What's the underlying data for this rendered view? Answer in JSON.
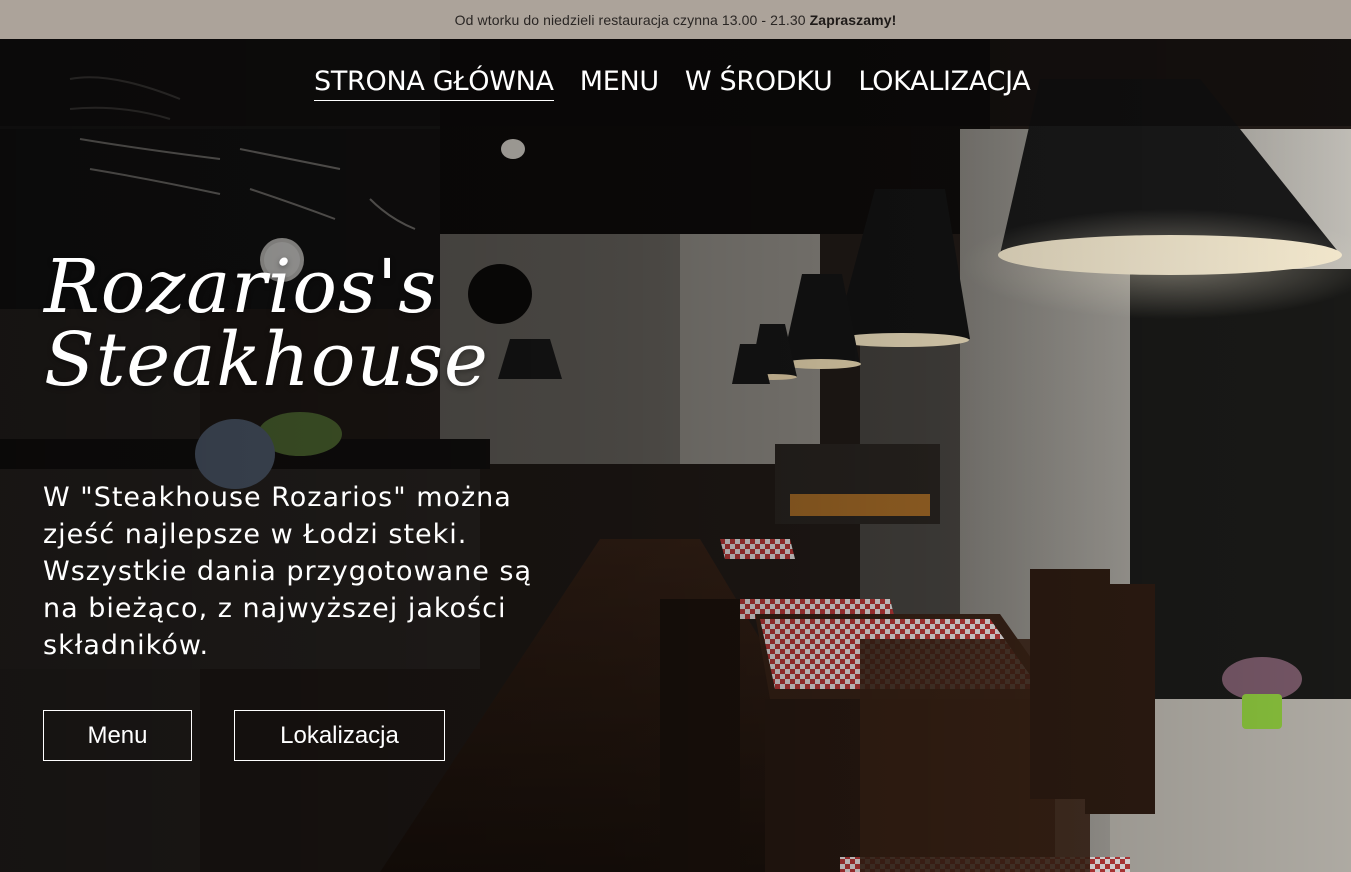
{
  "topbar": {
    "text": "Od wtorku do niedzieli restauracja czynna 13.00 - 21.30",
    "emphasis": "Zapraszamy!"
  },
  "nav": {
    "items": [
      {
        "label": "STRONA GŁÓWNA",
        "active": true
      },
      {
        "label": "MENU",
        "active": false
      },
      {
        "label": "W ŚRODKU",
        "active": false
      },
      {
        "label": "LOKALIZACJA",
        "active": false
      }
    ]
  },
  "hero": {
    "title_line1": "Rozarios's",
    "title_line2": "Steakhouse",
    "intro": "W \"Steakhouse Rozarios\" można zjeść najlepsze w Łodzi steki. Wszystkie dania przygotowane są na bieżąco, z najwyższej jakości składników.",
    "buttons": {
      "menu": "Menu",
      "location": "Lokalizacja"
    },
    "background_image": "restaurant-interior-photo"
  },
  "colors": {
    "topbar_bg": "#aca39a",
    "text": "#ffffff"
  }
}
